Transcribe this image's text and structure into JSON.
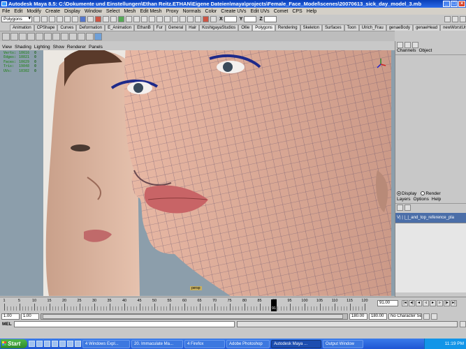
{
  "window": {
    "title": "Autodesk Maya 8.5: C:\\Dokumente und Einstellungen\\Ethan Reitz.ETHAN\\Eigene Dateien\\maya\\projects\\Female_Face_Model\\scenes\\20070613_sick_day_model_3.mb"
  },
  "menu": [
    "File",
    "Edit",
    "Modify",
    "Create",
    "Display",
    "Window",
    "Select",
    "Mesh",
    "Edit Mesh",
    "Proxy",
    "Normals",
    "Color",
    "Create UVs",
    "Edit UVs",
    "Comet",
    "CPS",
    "Help"
  ],
  "status": {
    "mode": "Polygons"
  },
  "shelf_tabs": [
    "Animation",
    "CPShape",
    "Curves",
    "Deformation",
    "E_Animation",
    "EthanB",
    "Fur",
    "General",
    "Hair",
    "KoshigayaStudios",
    "Ollie",
    "Polygons",
    "Rendering",
    "Skeleton",
    "Surfaces",
    "Toon",
    "Ulrich_Frau",
    "genaeBody",
    "genaeHead",
    "newWorstUndNEU"
  ],
  "viewport": {
    "menu": [
      "View",
      "Shading",
      "Lighting",
      "Show",
      "Renderer",
      "Panels"
    ],
    "hud": [
      {
        "k": "Verts:",
        "v": "10616",
        "z": "0"
      },
      {
        "k": "Edges:",
        "v": "10821",
        "z": "0"
      },
      {
        "k": "Faces:",
        "v": "10629",
        "z": "0"
      },
      {
        "k": "Tris:",
        "v": "19848",
        "z": "0"
      },
      {
        "k": "UVs:",
        "v": "10302",
        "z": "0"
      }
    ],
    "camera_label": "persp"
  },
  "channel_box": {
    "tabs": [
      "Channels",
      "Object"
    ],
    "display_label": "Display",
    "render_label": "Render",
    "layer_menu": [
      "Layers",
      "Options",
      "Help"
    ],
    "layer_name": "V| | |_|_and_top_reference_pla"
  },
  "timeline": {
    "ticks": [
      "1",
      "5",
      "10",
      "15",
      "20",
      "25",
      "30",
      "35",
      "40",
      "45",
      "50",
      "55",
      "60",
      "65",
      "70",
      "75",
      "80",
      "85",
      "90",
      "95",
      "100",
      "105",
      "110",
      "115",
      "120"
    ],
    "current_frame": "91",
    "current_time_field": "91.00",
    "range_start": "1.00",
    "range_start_inner": "1.00",
    "range_end_inner": "180.00",
    "range_end": "180.00",
    "character_set": "No Character Set"
  },
  "cmdline": {
    "label": "MEL"
  },
  "taskbar": {
    "start_label": "Start",
    "items": [
      {
        "label": "4 Windows Expl...",
        "active": false
      },
      {
        "label": "20. Immaculate Ma...",
        "active": false
      },
      {
        "label": "4 Firefox",
        "active": false
      },
      {
        "label": "Adobe Photoshop",
        "active": false
      },
      {
        "label": "Autodesk Maya ...",
        "active": true
      },
      {
        "label": "Output Window",
        "active": false
      }
    ],
    "clock": "11:19 PM"
  },
  "colors": {
    "layer_row": "#4b6ea8",
    "taskbar": "#2a62d8",
    "hud_text": "#3a8a3a"
  }
}
